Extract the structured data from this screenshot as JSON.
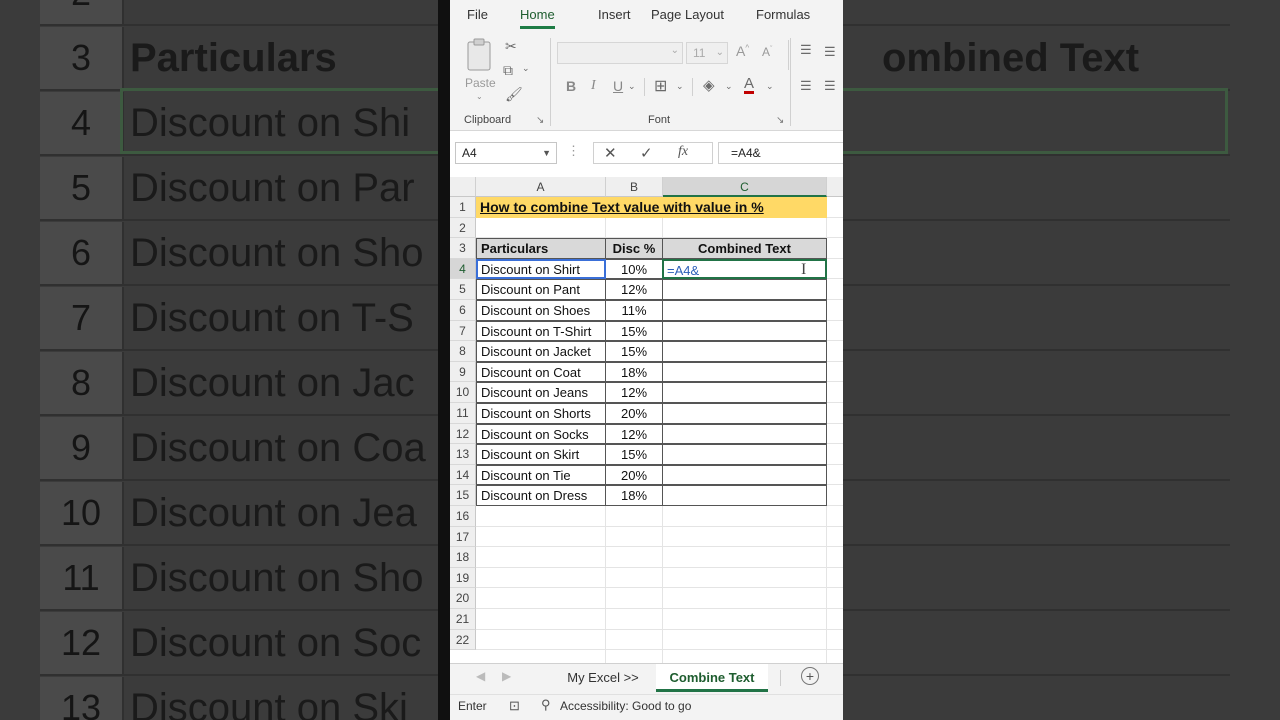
{
  "backdrop": {
    "rows": [
      {
        "num": "2",
        "text": ""
      },
      {
        "num": "3",
        "text": "Particulars",
        "right": "ombined Text"
      },
      {
        "num": "4",
        "text": "Discount on Shi"
      },
      {
        "num": "5",
        "text": "Discount on Par"
      },
      {
        "num": "6",
        "text": "Discount on Sho"
      },
      {
        "num": "7",
        "text": "Discount on T-S"
      },
      {
        "num": "8",
        "text": "Discount on Jac"
      },
      {
        "num": "9",
        "text": "Discount on Coa"
      },
      {
        "num": "10",
        "text": "Discount on Jea"
      },
      {
        "num": "11",
        "text": "Discount on Sho"
      },
      {
        "num": "12",
        "text": "Discount on Soc"
      },
      {
        "num": "13",
        "text": "Discount on Ski"
      }
    ]
  },
  "ribbon": {
    "tabs": [
      "File",
      "Home",
      "Insert",
      "Page Layout",
      "Formulas"
    ],
    "active_tab": "Home",
    "clipboard": {
      "paste_label": "Paste",
      "group_label": "Clipboard"
    },
    "font": {
      "size": "11",
      "group_label": "Font",
      "bold": "B",
      "italic": "I",
      "underline": "U"
    }
  },
  "formula_bar": {
    "name_box": "A4",
    "formula": "=A4&"
  },
  "sheet": {
    "columns": [
      "A",
      "B",
      "C"
    ],
    "title": "How to combine Text value with value in %",
    "headers": {
      "particulars": "Particulars",
      "disc": "Disc %",
      "combined": "Combined Text"
    },
    "rows": [
      {
        "particular": "Discount on Shirt",
        "disc": "10%",
        "combined": "=A4&"
      },
      {
        "particular": "Discount on Pant",
        "disc": "12%",
        "combined": ""
      },
      {
        "particular": "Discount on Shoes",
        "disc": "11%",
        "combined": ""
      },
      {
        "particular": "Discount on T-Shirt",
        "disc": "15%",
        "combined": ""
      },
      {
        "particular": "Discount on Jacket",
        "disc": "15%",
        "combined": ""
      },
      {
        "particular": "Discount on Coat",
        "disc": "18%",
        "combined": ""
      },
      {
        "particular": "Discount on Jeans",
        "disc": "12%",
        "combined": ""
      },
      {
        "particular": "Discount on Shorts",
        "disc": "20%",
        "combined": ""
      },
      {
        "particular": "Discount on Socks",
        "disc": "12%",
        "combined": ""
      },
      {
        "particular": "Discount on Skirt",
        "disc": "15%",
        "combined": ""
      },
      {
        "particular": "Discount on Tie",
        "disc": "20%",
        "combined": ""
      },
      {
        "particular": "Discount on Dress",
        "disc": "18%",
        "combined": ""
      }
    ],
    "row_numbers": [
      "1",
      "2",
      "3",
      "4",
      "5",
      "6",
      "7",
      "8",
      "9",
      "10",
      "11",
      "12",
      "13",
      "14",
      "15",
      "16",
      "17",
      "18",
      "19",
      "20",
      "21",
      "22"
    ],
    "active_cell": "C4",
    "title_fill": "#ffd966"
  },
  "sheet_tabs": {
    "tabs": [
      "My Excel >>",
      "Combine Text"
    ],
    "active": "Combine Text"
  },
  "status_bar": {
    "mode": "Enter",
    "accessibility": "Accessibility: Good to go"
  },
  "colors": {
    "accent": "#217346",
    "title_fill": "#ffd966",
    "header_fill": "#d9d9d9"
  }
}
